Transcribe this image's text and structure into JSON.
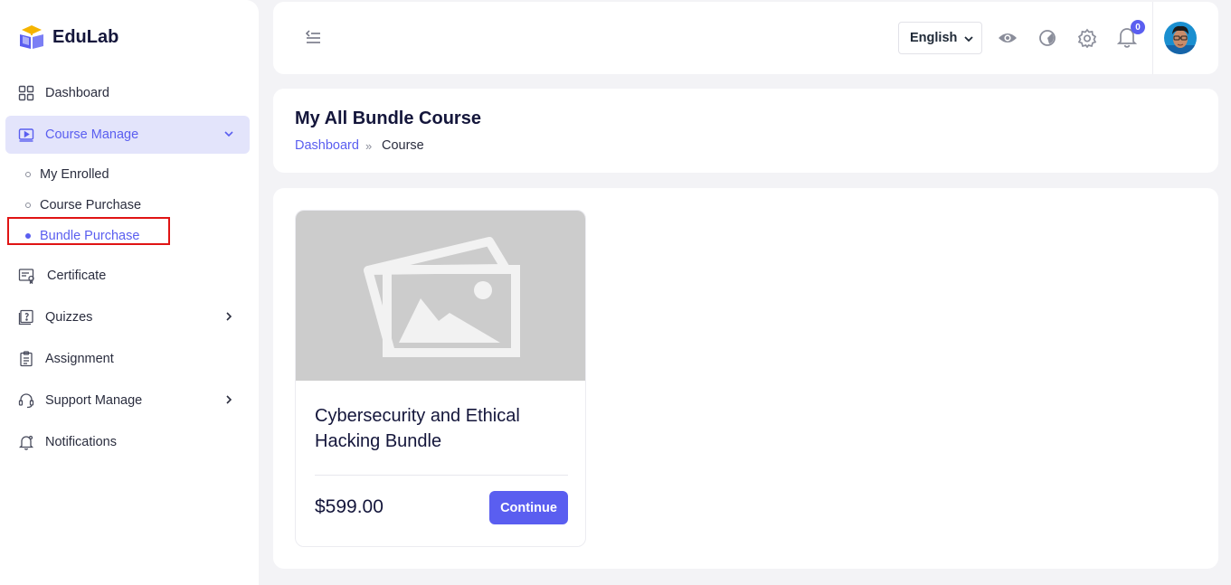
{
  "brand": {
    "name": "EduLab"
  },
  "sidebar": {
    "items": [
      {
        "label": "Dashboard"
      },
      {
        "label": "Course Manage"
      },
      {
        "label": "Certificate"
      },
      {
        "label": "Quizzes"
      },
      {
        "label": "Assignment"
      },
      {
        "label": "Support Manage"
      },
      {
        "label": "Notifications"
      }
    ],
    "sub_items": [
      {
        "label": "My Enrolled"
      },
      {
        "label": "Course Purchase"
      },
      {
        "label": "Bundle Purchase",
        "active": true
      }
    ]
  },
  "topbar": {
    "language": "English",
    "notification_count": "0",
    "icons": [
      "sidebar-toggle-icon",
      "eye-icon",
      "theme-icon",
      "gear-icon",
      "bell-icon"
    ]
  },
  "header": {
    "title": "My All Bundle Course",
    "breadcrumb": {
      "link": "Dashboard",
      "separator": "»",
      "current": "Course"
    }
  },
  "bundles": [
    {
      "title": "Cybersecurity and Ethical Hacking Bundle",
      "price": "$599.00",
      "button": "Continue"
    }
  ],
  "colors": {
    "accent": "#5a5ef0",
    "active_bg": "#e3e4fb",
    "highlight": "#e01414"
  }
}
